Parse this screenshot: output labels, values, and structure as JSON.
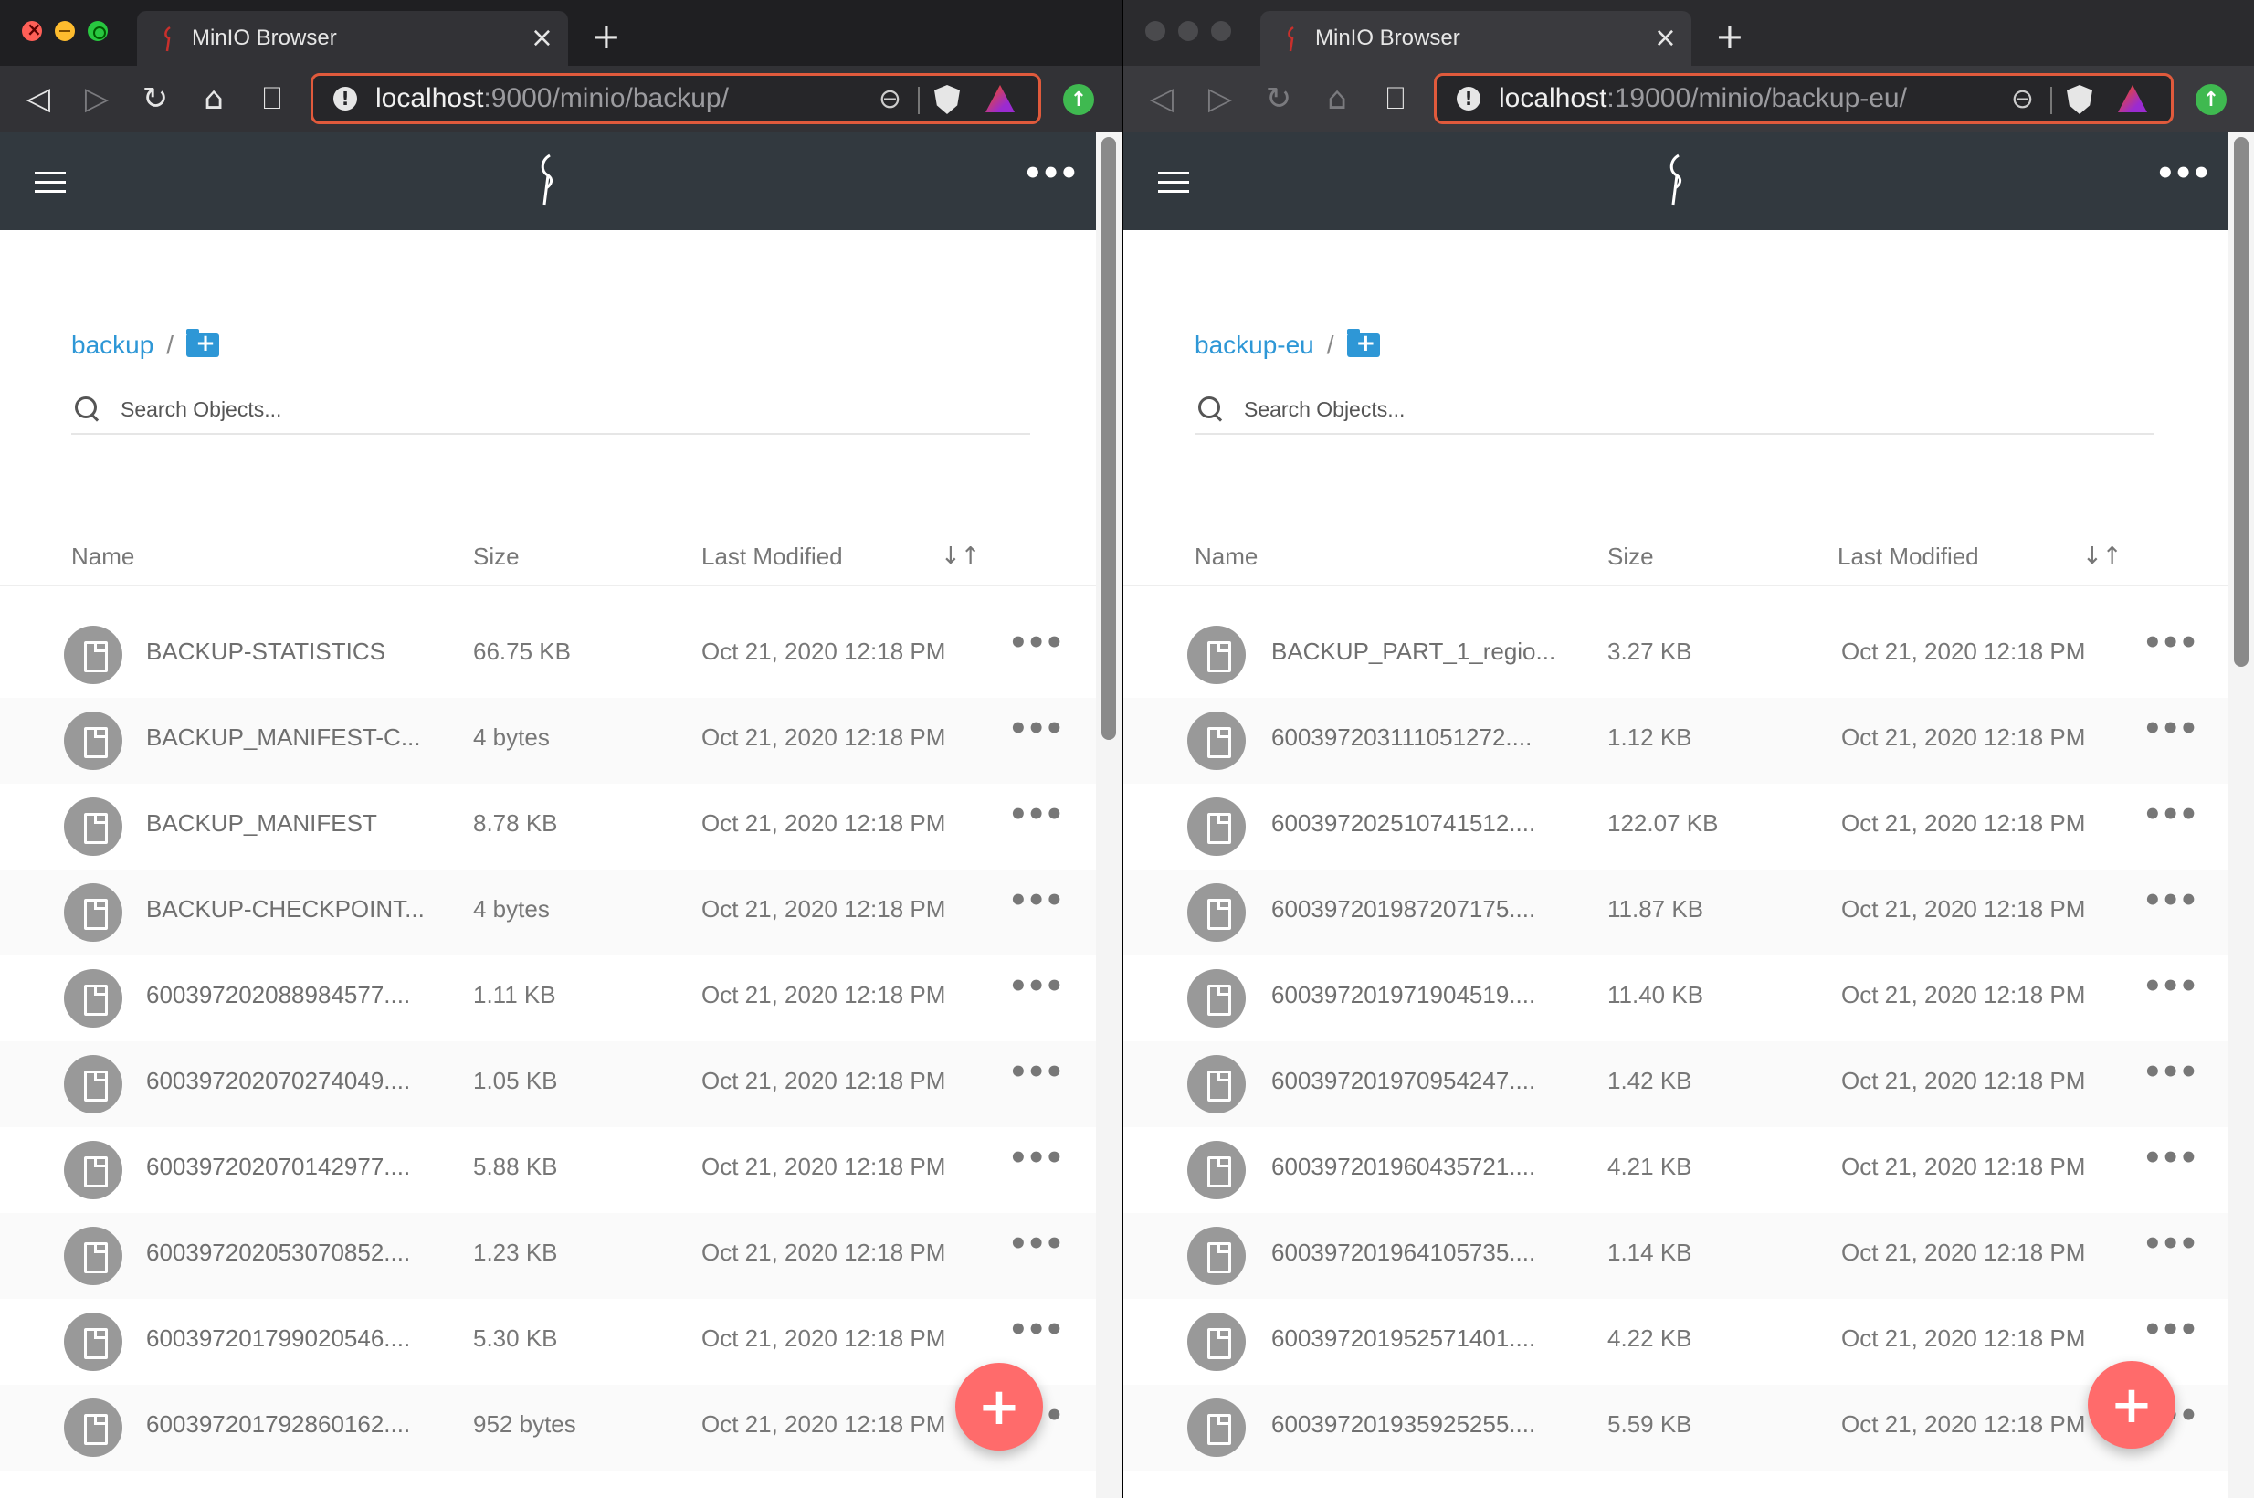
{
  "windows": [
    {
      "tab_title": "MinIO Browser",
      "url_host": "localhost",
      "url_rest": ":9000/minio/backup/",
      "bucket": "backup",
      "search_placeholder": "Search Objects...",
      "columns": {
        "name": "Name",
        "size": "Size",
        "modified": "Last Modified"
      },
      "objects": [
        {
          "name": "BACKUP-STATISTICS",
          "size": "66.75 KB",
          "modified": "Oct 21, 2020 12:18 PM"
        },
        {
          "name": "BACKUP_MANIFEST-C...",
          "size": "4 bytes",
          "modified": "Oct 21, 2020 12:18 PM"
        },
        {
          "name": "BACKUP_MANIFEST",
          "size": "8.78 KB",
          "modified": "Oct 21, 2020 12:18 PM"
        },
        {
          "name": "BACKUP-CHECKPOINT...",
          "size": "4 bytes",
          "modified": "Oct 21, 2020 12:18 PM"
        },
        {
          "name": "600397202088984577....",
          "size": "1.11 KB",
          "modified": "Oct 21, 2020 12:18 PM"
        },
        {
          "name": "600397202070274049....",
          "size": "1.05 KB",
          "modified": "Oct 21, 2020 12:18 PM"
        },
        {
          "name": "600397202070142977....",
          "size": "5.88 KB",
          "modified": "Oct 21, 2020 12:18 PM"
        },
        {
          "name": "600397202053070852....",
          "size": "1.23 KB",
          "modified": "Oct 21, 2020 12:18 PM"
        },
        {
          "name": "600397201799020546....",
          "size": "5.30 KB",
          "modified": "Oct 21, 2020 12:18 PM"
        },
        {
          "name": "600397201792860162....",
          "size": "952 bytes",
          "modified": "Oct 21, 2020 12:18 PM"
        }
      ]
    },
    {
      "tab_title": "MinIO Browser",
      "url_host": "localhost",
      "url_rest": ":19000/minio/backup-eu/",
      "bucket": "backup-eu",
      "search_placeholder": "Search Objects...",
      "columns": {
        "name": "Name",
        "size": "Size",
        "modified": "Last Modified"
      },
      "objects": [
        {
          "name": "BACKUP_PART_1_regio...",
          "size": "3.27 KB",
          "modified": "Oct 21, 2020 12:18 PM"
        },
        {
          "name": "600397203111051272....",
          "size": "1.12 KB",
          "modified": "Oct 21, 2020 12:18 PM"
        },
        {
          "name": "600397202510741512....",
          "size": "122.07 KB",
          "modified": "Oct 21, 2020 12:18 PM"
        },
        {
          "name": "600397201987207175....",
          "size": "11.87 KB",
          "modified": "Oct 21, 2020 12:18 PM"
        },
        {
          "name": "600397201971904519....",
          "size": "11.40 KB",
          "modified": "Oct 21, 2020 12:18 PM"
        },
        {
          "name": "600397201970954247....",
          "size": "1.42 KB",
          "modified": "Oct 21, 2020 12:18 PM"
        },
        {
          "name": "600397201960435721....",
          "size": "4.21 KB",
          "modified": "Oct 21, 2020 12:18 PM"
        },
        {
          "name": "600397201964105735....",
          "size": "1.14 KB",
          "modified": "Oct 21, 2020 12:18 PM"
        },
        {
          "name": "600397201952571401....",
          "size": "4.22 KB",
          "modified": "Oct 21, 2020 12:18 PM"
        },
        {
          "name": "600397201935925255....",
          "size": "5.59 KB",
          "modified": "Oct 21, 2020 12:18 PM"
        }
      ]
    }
  ],
  "colors": {
    "accent": "#2e97d6",
    "fab": "#ff6b6b",
    "header": "#32393f",
    "url_border": "#e05a3c"
  }
}
